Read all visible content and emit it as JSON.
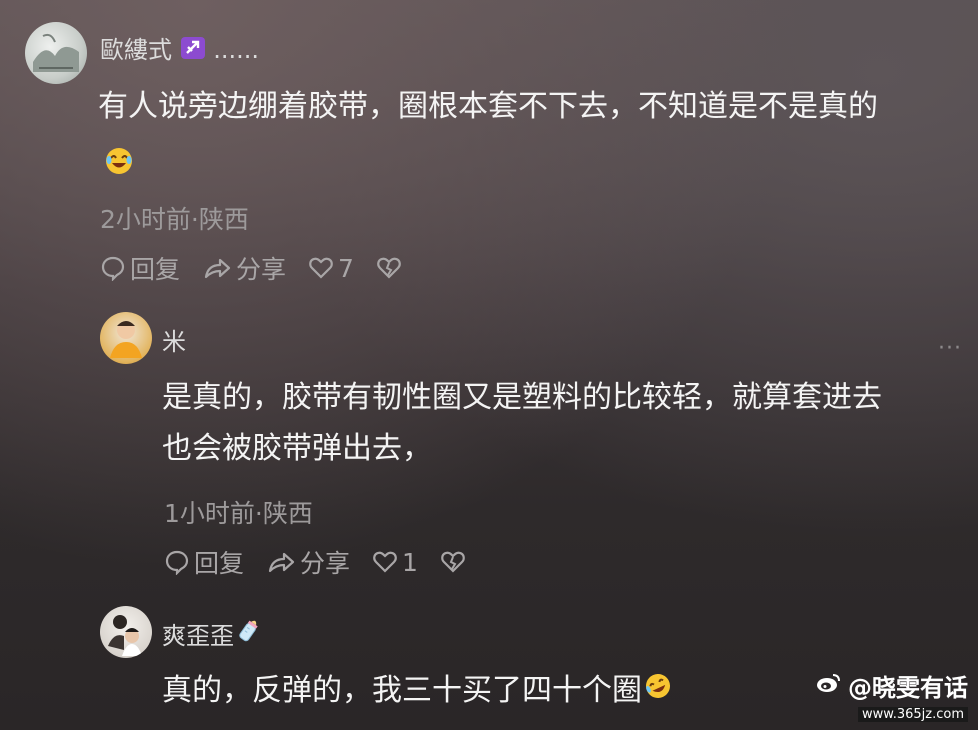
{
  "comments": [
    {
      "username": "歐縷式",
      "username_suffix": "......",
      "text": "有人说旁边绷着胶带，圈根本套不下去，不知道是不是真的",
      "meta": "2小时前·陕西",
      "actions": {
        "reply": "回复",
        "share": "分享",
        "likes": "7"
      }
    },
    {
      "username": "米",
      "text_line1": "是真的，胶带有韧性圈又是塑料的比较轻，就算套进去",
      "text_line2": "也会被胶带弹出去，",
      "meta": "1小时前·陕西",
      "actions": {
        "reply": "回复",
        "share": "分享",
        "likes": "1"
      }
    },
    {
      "username": "爽歪歪",
      "text": "真的，反弹的，我三十买了四十个圈"
    }
  ],
  "more_menu": "···",
  "watermark": {
    "main": "@晓雯有话",
    "url": "www.365jz.com"
  },
  "icons": [
    "reply-icon",
    "share-icon",
    "heart-icon",
    "dislike-icon",
    "more-icon",
    "sagittarius-icon",
    "laughing-emoji-icon",
    "baby-bottle-icon",
    "rofl-emoji-icon",
    "weibo-logo-icon"
  ]
}
